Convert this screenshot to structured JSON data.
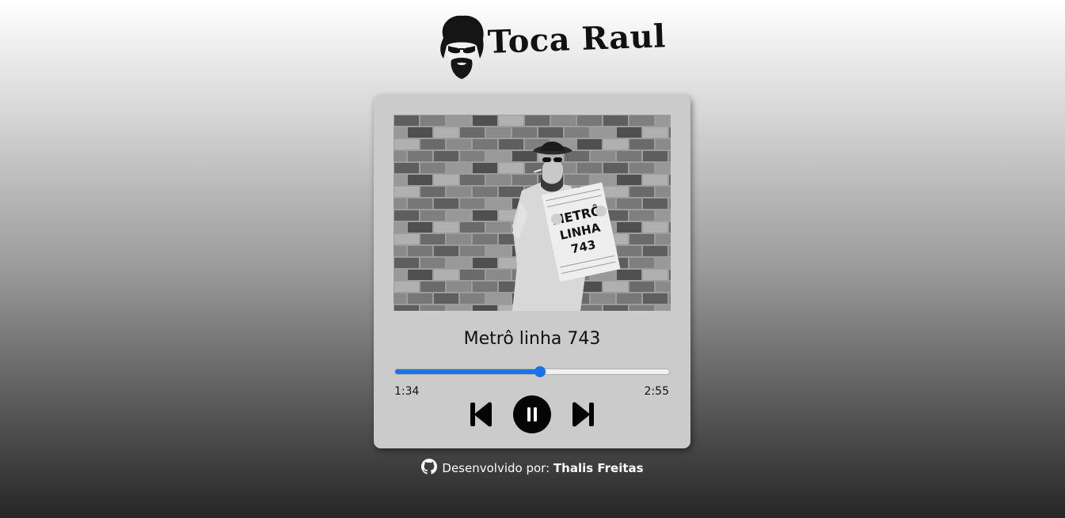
{
  "header": {
    "logo_icon": "raul-face-logo-icon",
    "brand_text": "Toca Raul"
  },
  "player": {
    "album_art_icon": "album-art-image",
    "newspaper_text": [
      "METRÔ",
      "LINHA",
      "743"
    ],
    "song_title": "Metrô linha 743",
    "progress_fraction": 0.53,
    "current_time": "1:34",
    "total_time": "2:55",
    "accent_color": "#1a73e8",
    "controls": {
      "previous_icon": "skip-previous-icon",
      "pause_icon": "pause-icon",
      "next_icon": "skip-next-icon"
    }
  },
  "footer": {
    "icon": "github-icon",
    "prefix": "Desenvolvido por:",
    "author": "Thalis Freitas"
  }
}
